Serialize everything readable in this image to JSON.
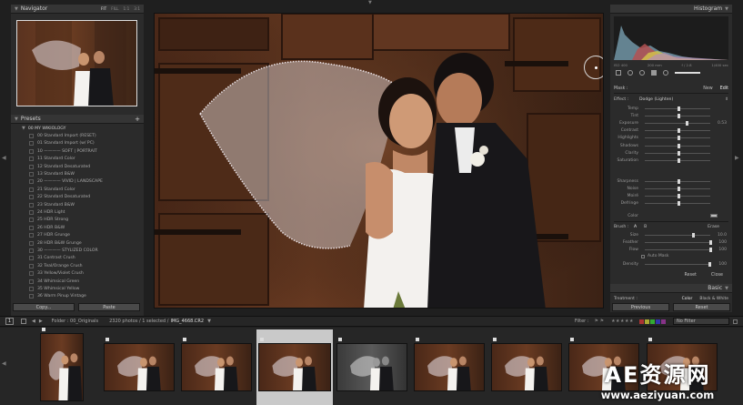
{
  "navigator": {
    "title": "Navigator",
    "zoom_options": [
      "FIT",
      "FILL",
      "1:1",
      "3:1"
    ]
  },
  "presets": {
    "title": "Presets",
    "folder": "00 MY WIKIOLOGY",
    "items": [
      "00 Standard Import (RESET)",
      "01 Standard Import (w/ PC)",
      "10 ———— SOFT | PORTRAIT",
      "11 Standard Color",
      "12 Standard Desaturated",
      "13 Standard B&W",
      "20 ———— VIVID | LANDSCAPE",
      "21 Standard Color",
      "22 Standard Desaturated",
      "23 Standard B&W",
      "24 HDR Light",
      "25 HDR Strong",
      "26 HDR B&W",
      "27 HDR Grunge",
      "28 HDR B&W Grunge",
      "30 ———— STYLIZED COLOR",
      "31 Contrast Crush",
      "32 Teal/Orange Crush",
      "33 Yellow/Violet Crush",
      "34 Whimsical Green",
      "35 Whimsical Yellow",
      "36 Warm Pinup Vintage"
    ]
  },
  "left_buttons": {
    "copy": "Copy...",
    "paste": "Paste"
  },
  "histogram": {
    "title": "Histogram",
    "meta": [
      "ISO 400",
      "200 mm",
      "f / 2.8",
      "1/400 sec"
    ]
  },
  "mask": {
    "label": "Mask :",
    "new": "New",
    "edit": "Edit",
    "effect_label": "Effect :",
    "effect_value": "Dodge (Lighten)",
    "sliders": [
      {
        "label": "Temp",
        "pos": 0.5,
        "val": ""
      },
      {
        "label": "Tint",
        "pos": 0.5,
        "val": ""
      },
      {
        "label": "Exposure",
        "pos": 0.62,
        "val": "0.53"
      },
      {
        "label": "Contrast",
        "pos": 0.5,
        "val": ""
      },
      {
        "label": "Highlights",
        "pos": 0.5,
        "val": ""
      },
      {
        "label": "Shadows",
        "pos": 0.5,
        "val": ""
      },
      {
        "label": "Clarity",
        "pos": 0.5,
        "val": ""
      },
      {
        "label": "Saturation",
        "pos": 0.5,
        "val": ""
      }
    ],
    "sliders2": [
      {
        "label": "Sharpness",
        "pos": 0.5,
        "val": ""
      },
      {
        "label": "Noise",
        "pos": 0.5,
        "val": ""
      },
      {
        "label": "Moiré",
        "pos": 0.5,
        "val": ""
      },
      {
        "label": "Defringe",
        "pos": 0.5,
        "val": ""
      }
    ],
    "color_label": "Color"
  },
  "brush": {
    "label": "Brush :",
    "a": "A",
    "b": "B",
    "erase": "Erase",
    "rows": [
      {
        "label": "Size",
        "pos": 0.72,
        "val": "10.0"
      },
      {
        "label": "Feather",
        "pos": 0.98,
        "val": "100"
      },
      {
        "label": "Flow",
        "pos": 0.98,
        "val": "100"
      }
    ],
    "auto_mask": "Auto Mask",
    "density_label": "Density",
    "density_val": "100",
    "reset": "Reset",
    "close": "Close"
  },
  "basic": {
    "title": "Basic",
    "treatment_label": "Treatment :",
    "color": "Color",
    "bw": "Black & White"
  },
  "right_buttons": {
    "previous": "Previous",
    "reset": "Reset"
  },
  "filmstrip_bar": {
    "page": "1",
    "source": "Folder : 00_Originals",
    "count": "2320 photos / 1 selected /",
    "file": "IMG_4668.CR2",
    "filter_label": "Filter :",
    "filter_value": "No Filter"
  },
  "watermark": {
    "line1": "AE资源网",
    "line2": "www.aeziyuan.com"
  },
  "colors": {
    "accent": "#d9d9d9",
    "panel": "#2b2b2b",
    "background": "#1f1f1f"
  }
}
